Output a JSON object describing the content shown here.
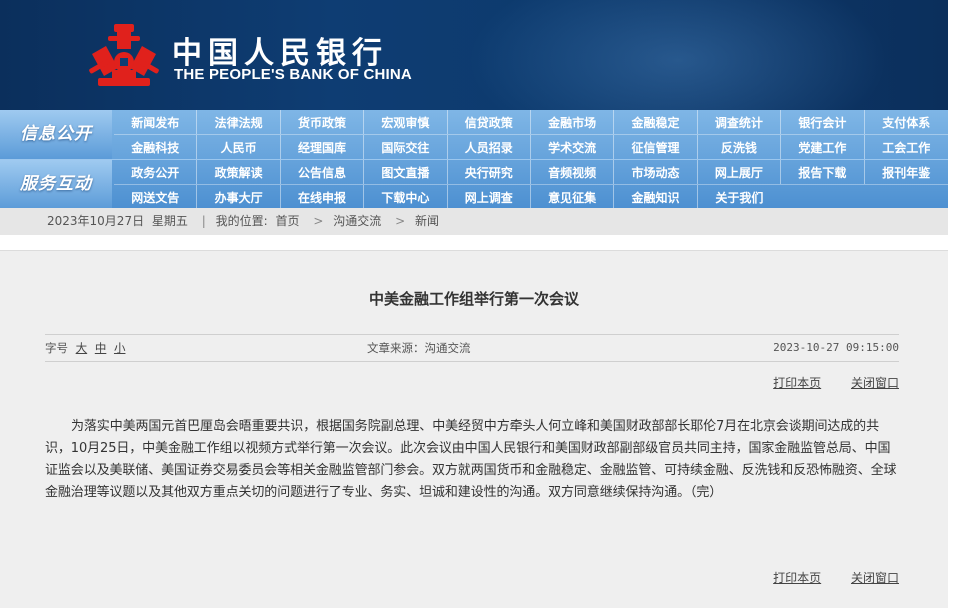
{
  "header": {
    "logo_cn": "中国人民银行",
    "logo_en": "THE PEOPLE'S BANK OF CHINA",
    "colors": {
      "banner": "#0e3d73",
      "logo_red": "#e0211c"
    }
  },
  "nav": {
    "sections": [
      {
        "title": "信息公开",
        "rows": [
          [
            "新闻发布",
            "法律法规",
            "货币政策",
            "宏观审慎",
            "信贷政策",
            "金融市场",
            "金融稳定",
            "调查统计",
            "银行会计",
            "支付体系"
          ],
          [
            "金融科技",
            "人民币",
            "经理国库",
            "国际交往",
            "人员招录",
            "学术交流",
            "征信管理",
            "反洗钱",
            "党建工作",
            "工会工作"
          ]
        ]
      },
      {
        "title": "服务互动",
        "rows": [
          [
            "政务公开",
            "政策解读",
            "公告信息",
            "图文直播",
            "央行研究",
            "音频视频",
            "市场动态",
            "网上展厅",
            "报告下载",
            "报刊年鉴"
          ],
          [
            "网送文告",
            "办事大厅",
            "在线申报",
            "下载中心",
            "网上调查",
            "意见征集",
            "金融知识",
            "关于我们"
          ]
        ]
      }
    ]
  },
  "breadcrumb": {
    "date": "2023年10月27日",
    "weekday": "星期五",
    "location_label": "我的位置:",
    "items": [
      "首页",
      "沟通交流",
      "新闻"
    ]
  },
  "article": {
    "title": "中美金融工作组举行第一次会议",
    "font_size_label": "字号",
    "font_sizes": [
      "大",
      "中",
      "小"
    ],
    "source": "文章来源：沟通交流",
    "datetime": "2023-10-27 09:15:00",
    "print_label": "打印本页",
    "close_label": "关闭窗口",
    "body": "为落实中美两国元首巴厘岛会晤重要共识，根据国务院副总理、中美经贸中方牵头人何立峰和美国财政部部长耶伦7月在北京会谈期间达成的共识，10月25日，中美金融工作组以视频方式举行第一次会议。此次会议由中国人民银行和美国财政部副部级官员共同主持，国家金融监管总局、中国证监会以及美联储、美国证券交易委员会等相关金融监管部门参会。双方就两国货币和金融稳定、金融监管、可持续金融、反洗钱和反恐怖融资、全球金融治理等议题以及其他双方重点关切的问题进行了专业、务实、坦诚和建设性的沟通。双方同意继续保持沟通。（完）"
  }
}
